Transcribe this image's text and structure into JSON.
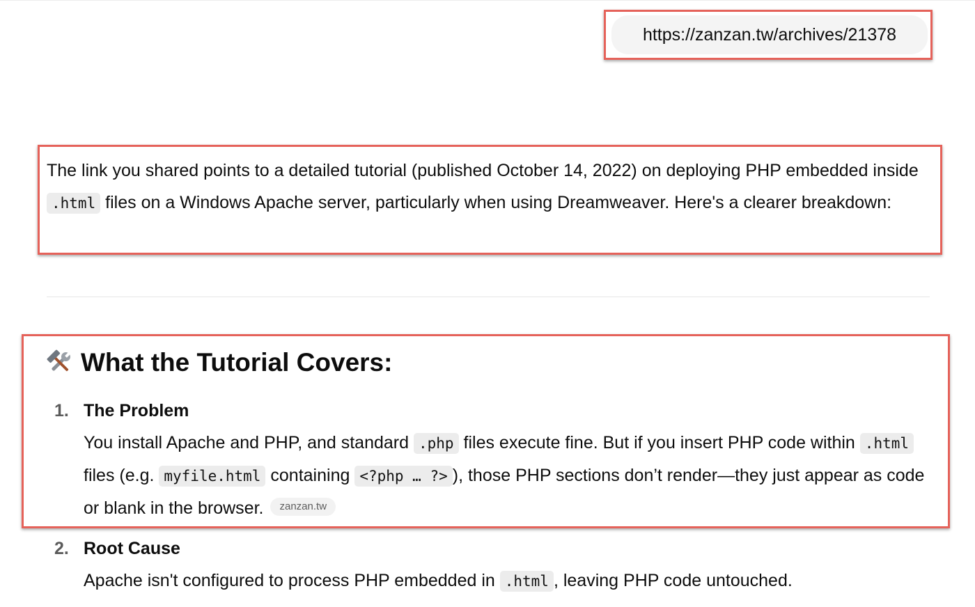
{
  "user_message": {
    "text": "https://zanzan.tw/archives/21378"
  },
  "intro": {
    "part1": "The link you shared points to a detailed tutorial (published October 14, 2022) on deploying PHP embedded inside ",
    "code1": ".html",
    "part2": " files on a Windows Apache server, particularly when using Dreamweaver. Here's a clearer breakdown:"
  },
  "section": {
    "icon": "hammer-and-wrench-icon",
    "heading": "What the Tutorial Covers:"
  },
  "steps": [
    {
      "number": "1.",
      "title": "The Problem",
      "body": {
        "t1": "You install Apache and PHP, and standard ",
        "c1": ".php",
        "t2": " files execute fine. But if you insert PHP code within ",
        "c2": ".html",
        "t3": " files (e.g. ",
        "c3": "myfile.html",
        "t4": " containing ",
        "c4": "<?php … ?>",
        "t5": "), those PHP sections don’t render—they just appear as code or blank in the browser.",
        "citation": "zanzan.tw"
      }
    },
    {
      "number": "2.",
      "title": "Root Cause",
      "body": {
        "t1": "Apache isn't configured to process PHP embedded in ",
        "c1": ".html",
        "t2": ", leaving PHP code untouched."
      }
    }
  ],
  "colors": {
    "highlight_border": "#e5625a",
    "bubble_bg": "#f4f4f4",
    "code_bg": "#ececec"
  }
}
